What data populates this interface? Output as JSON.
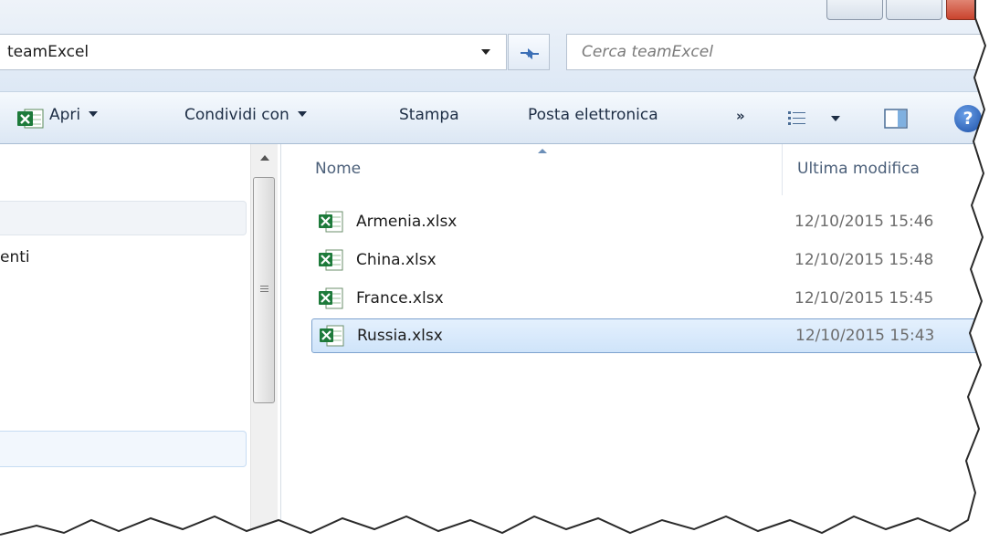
{
  "address_bar": {
    "path": "teamExcel"
  },
  "search": {
    "placeholder": "Cerca teamExcel"
  },
  "toolbar": {
    "open_label": "Apri",
    "share_label": "Condividi con",
    "print_label": "Stampa",
    "email_label": "Posta elettronica",
    "more_label": "»",
    "help_label": "?"
  },
  "navigation": {
    "item_label": "enti"
  },
  "file_list": {
    "columns": {
      "name": "Nome",
      "modified": "Ultima modifica"
    },
    "files": [
      {
        "name": "Armenia.xlsx",
        "modified": "12/10/2015 15:46"
      },
      {
        "name": "China.xlsx",
        "modified": "12/10/2015 15:48"
      },
      {
        "name": "France.xlsx",
        "modified": "12/10/2015 15:45"
      },
      {
        "name": "Russia.xlsx",
        "modified": "12/10/2015 15:43",
        "selected": true
      }
    ]
  },
  "colors": {
    "selection_fill": "#cfe4fa",
    "selection_border": "#7da2ce",
    "toolbar_text": "#1e2e45",
    "excel_green": "#1d7a3a"
  }
}
